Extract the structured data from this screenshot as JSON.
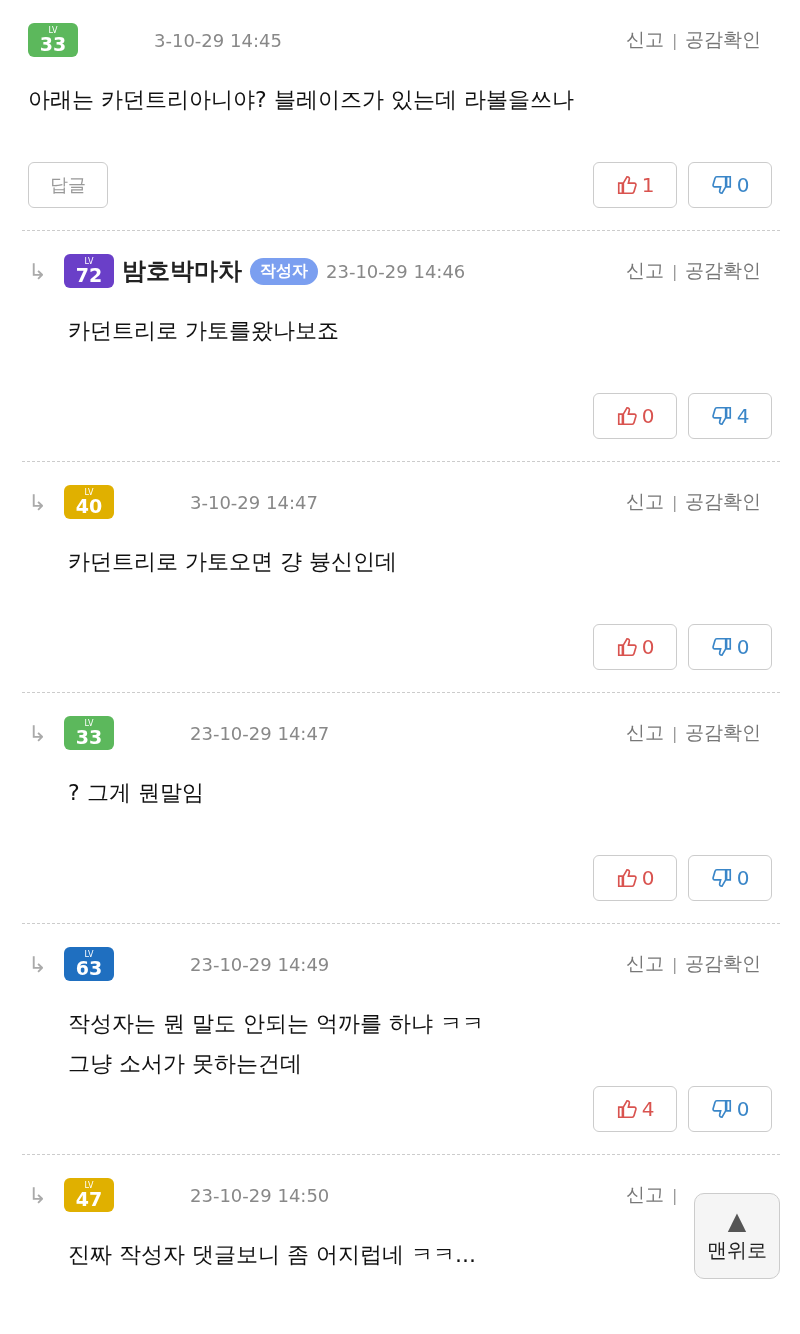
{
  "comments": [
    {
      "reply": false,
      "level_label": "LV",
      "level": "33",
      "color": "#5cb85c",
      "date": "3-10-29 14:45",
      "actions": [
        "신고",
        "|",
        "공감확인"
      ],
      "text": [
        "아래는 카던트리아니야? 블레이즈가 있는데 라볼을쓰나"
      ],
      "reply_button": "답글",
      "up": "1",
      "down": "0"
    },
    {
      "reply": true,
      "arrow": "↳",
      "level_label": "LV",
      "level": "72",
      "color": "#6a3fc8",
      "username": "밤호박마차",
      "tag": "작성자",
      "date": "23-10-29 14:46",
      "actions": [
        "신고",
        "|",
        "공감확인"
      ],
      "text": [
        "카던트리로 가토를왔나보죠"
      ],
      "up": "0",
      "down": "4"
    },
    {
      "reply": true,
      "arrow": "↳",
      "level_label": "LV",
      "level": "40",
      "color": "#e0b000",
      "date": "3-10-29 14:47",
      "actions": [
        "신고",
        "|",
        "공감확인"
      ],
      "text": [
        "카던트리로 가토오면 걍 븅신인데"
      ],
      "up": "0",
      "down": "0"
    },
    {
      "reply": true,
      "arrow": "↳",
      "level_label": "LV",
      "level": "33",
      "color": "#5cb85c",
      "date": "23-10-29 14:47",
      "actions": [
        "신고",
        "|",
        "공감확인"
      ],
      "text": [
        "? 그게 뭔말임"
      ],
      "up": "0",
      "down": "0"
    },
    {
      "reply": true,
      "arrow": "↳",
      "level_label": "LV",
      "level": "63",
      "color": "#1f6fc0",
      "date": "23-10-29 14:49",
      "actions": [
        "신고",
        "|",
        "공감확인"
      ],
      "text": [
        "작성자는 뭔 말도 안되는 억까를 하냐 ㅋㅋ",
        "그냥 소서가 못하는건데"
      ],
      "up": "4",
      "down": "0"
    },
    {
      "reply": true,
      "arrow": "↳",
      "level_label": "LV",
      "level": "47",
      "color": "#e0b000",
      "date": "23-10-29 14:50",
      "actions": [
        "신고",
        "|"
      ],
      "text": [
        "진짜 작성자 댓글보니 좀 어지럽네 ㅋㅋ..."
      ]
    }
  ],
  "top_button": {
    "arrow": "▲",
    "label": "맨위로"
  }
}
